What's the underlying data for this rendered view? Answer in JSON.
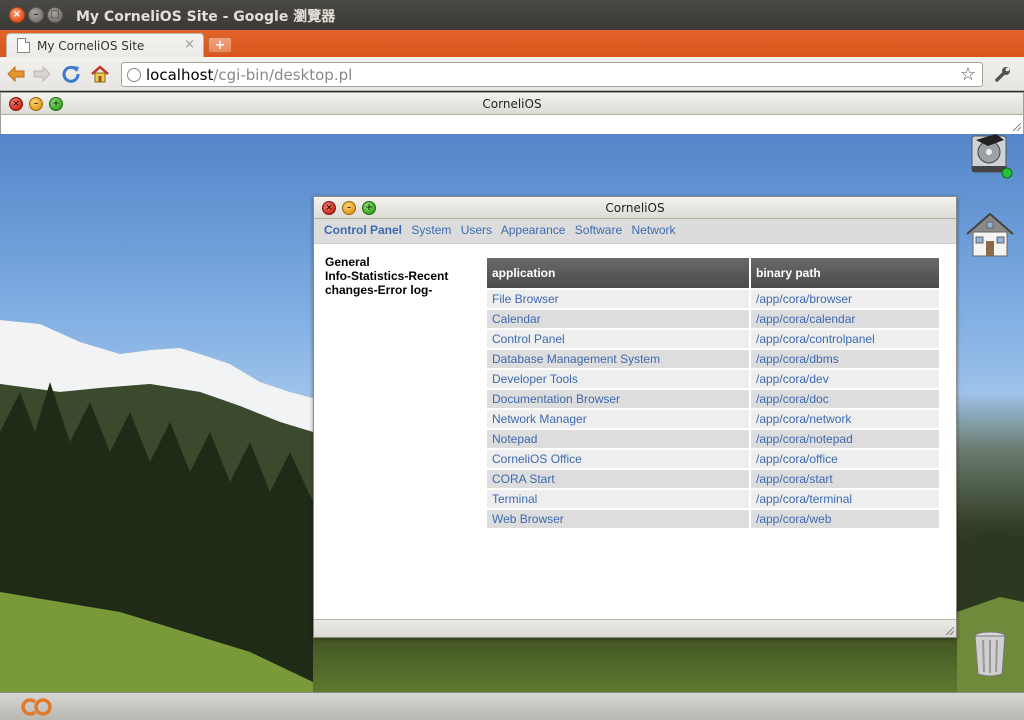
{
  "os": {
    "window_title": "My CorneliOS Site - Google 瀏覽器"
  },
  "browser": {
    "tab_title": "My CorneliOS Site",
    "tab_close": "×",
    "new_tab": "+",
    "url_host": "localhost",
    "url_path": "/cgi-bin/desktop.pl",
    "icons": {
      "back": "back-arrow-icon",
      "forward": "forward-arrow-icon",
      "reload": "reload-icon",
      "home": "home-icon",
      "star": "star-icon",
      "wrench": "wrench-icon"
    }
  },
  "top_window": {
    "title": "CorneliOS"
  },
  "main_window": {
    "title": "CorneliOS",
    "menu": [
      {
        "label": "Control Panel",
        "active": true
      },
      {
        "label": "System",
        "active": false
      },
      {
        "label": "Users",
        "active": false
      },
      {
        "label": "Appearance",
        "active": false
      },
      {
        "label": "Software",
        "active": false
      },
      {
        "label": "Network",
        "active": false
      }
    ],
    "sidebar_lines": [
      "General",
      "Info-Statistics-Recent",
      "changes-Error log-"
    ],
    "table": {
      "headers": [
        "application",
        "binary path"
      ],
      "rows": [
        [
          "File Browser",
          "/app/cora/browser"
        ],
        [
          "Calendar",
          "/app/cora/calendar"
        ],
        [
          "Control Panel",
          "/app/cora/controlpanel"
        ],
        [
          "Database Management System",
          "/app/cora/dbms"
        ],
        [
          "Developer Tools",
          "/app/cora/dev"
        ],
        [
          "Documentation Browser",
          "/app/cora/doc"
        ],
        [
          "Network Manager",
          "/app/cora/network"
        ],
        [
          "Notepad",
          "/app/cora/notepad"
        ],
        [
          "CorneliOS Office",
          "/app/cora/office"
        ],
        [
          "CORA Start",
          "/app/cora/start"
        ],
        [
          "Terminal",
          "/app/cora/terminal"
        ],
        [
          "Web Browser",
          "/app/cora/web"
        ]
      ]
    }
  },
  "desktop_icons": [
    "hard-drive-icon",
    "home-icon",
    "trash-icon"
  ],
  "colors": {
    "link": "#3d6ab0",
    "tabstrip": "#dd5a20",
    "table_header": "#5a5a5a"
  }
}
